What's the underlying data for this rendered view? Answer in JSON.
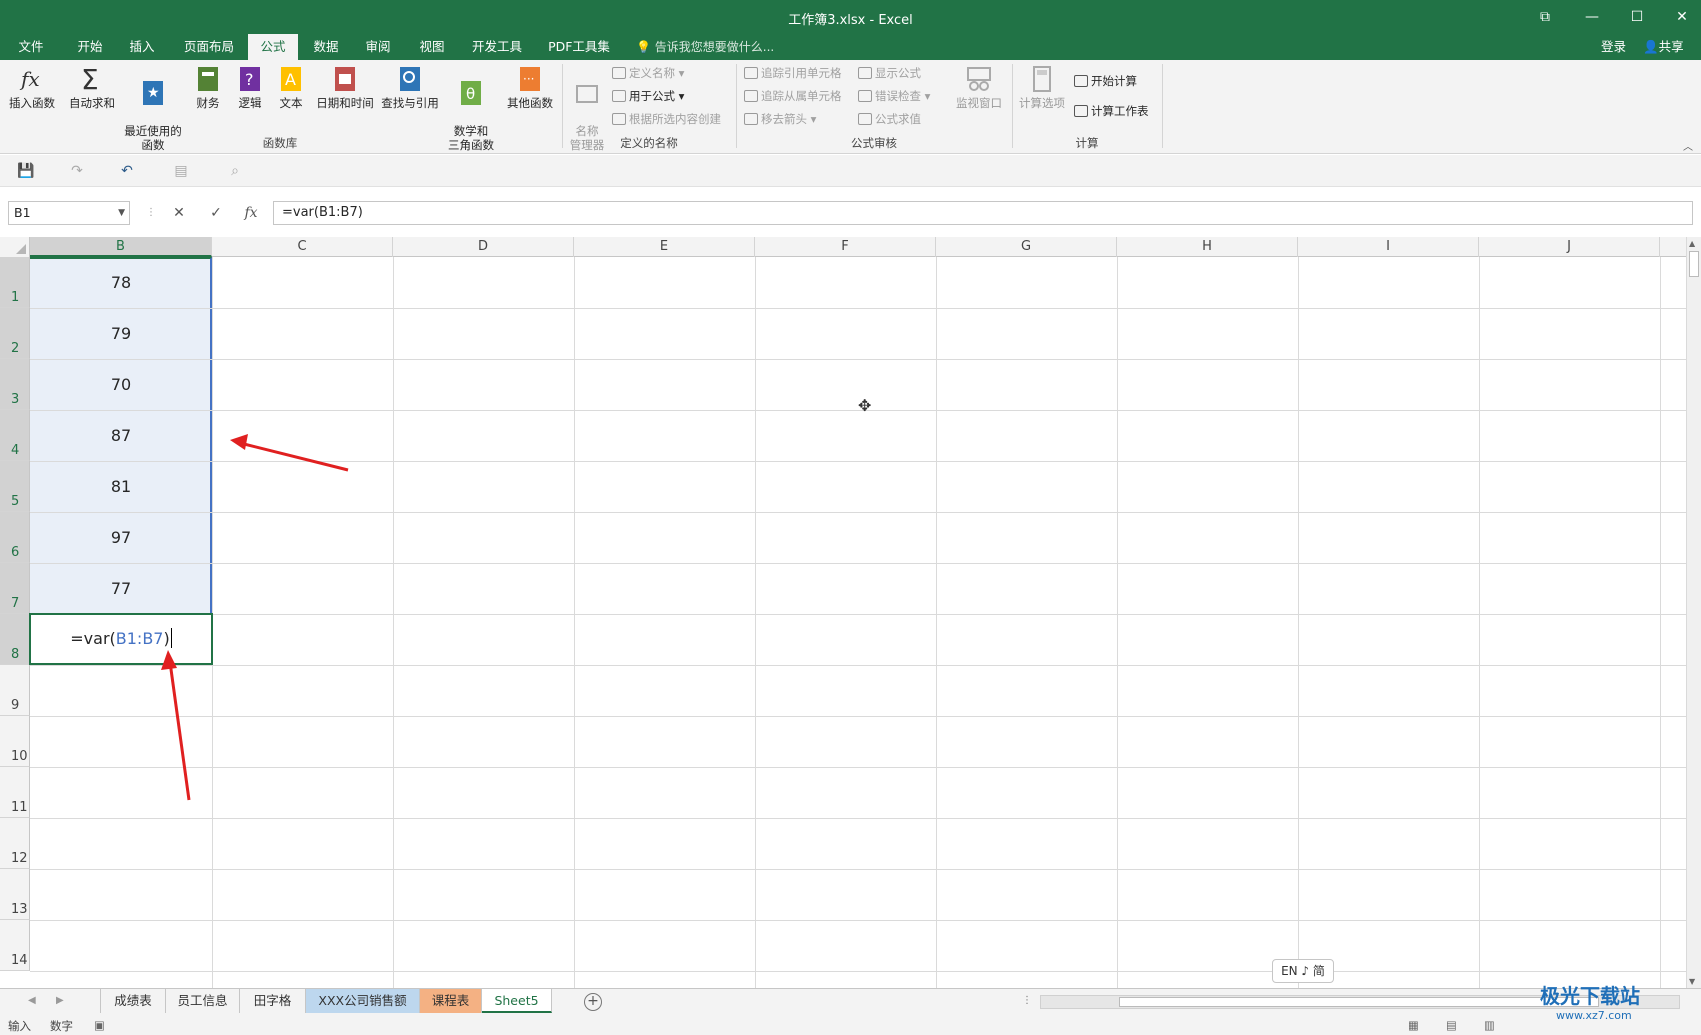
{
  "window": {
    "title": "工作簿3.xlsx - Excel",
    "controls": {
      "restore": "⧉",
      "minimize": "—",
      "maximize": "☐",
      "close": "✕"
    }
  },
  "tabs": [
    "文件",
    "开始",
    "插入",
    "页面布局",
    "公式",
    "数据",
    "审阅",
    "视图",
    "开发工具",
    "PDF工具集"
  ],
  "active_tab": "公式",
  "tell_me": "告诉我您想要做什么...",
  "login": "登录",
  "share": "共享",
  "ribbon": {
    "function_library": {
      "label": "函数库",
      "buttons": [
        "插入函数",
        "自动求和",
        "最近使用的\n函数",
        "财务",
        "逻辑",
        "文本",
        "日期和时间",
        "查找与引用",
        "数学和\n三角函数",
        "其他函数"
      ]
    },
    "defined_names": {
      "label": "定义的名称",
      "name_manager": "名称\n管理器",
      "items": [
        "定义名称",
        "用于公式",
        "根据所选内容创建"
      ]
    },
    "formula_auditing": {
      "label": "公式审核",
      "items": [
        "追踪引用单元格",
        "追踪从属单元格",
        "移去箭头",
        "显示公式",
        "错误检查",
        "公式求值"
      ],
      "watch_window": "监视窗口"
    },
    "calculation": {
      "label": "计算",
      "options": "计算选项",
      "items": [
        "开始计算",
        "计算工作表"
      ]
    }
  },
  "formula_bar": {
    "name_box": "B1",
    "formula": "=var(B1:B7)"
  },
  "columns": [
    "B",
    "C",
    "D",
    "E",
    "F",
    "G",
    "H",
    "I",
    "J"
  ],
  "rows": [
    "1",
    "2",
    "3",
    "4",
    "5",
    "6",
    "7",
    "8",
    "9",
    "10",
    "11",
    "12",
    "13",
    "14"
  ],
  "cells_B": [
    "78",
    "79",
    "70",
    "87",
    "81",
    "97",
    "77"
  ],
  "active_cell": {
    "prefix": "=var(",
    "ref": "B1:B7",
    "suffix": ")"
  },
  "ime": "EN ♪ 简",
  "sheets": [
    {
      "name": "成绩表",
      "style": "normal"
    },
    {
      "name": "员工信息",
      "style": "normal"
    },
    {
      "name": "田字格",
      "style": "normal"
    },
    {
      "name": "XXX公司销售额",
      "style": "blue"
    },
    {
      "name": "课程表",
      "style": "orange"
    },
    {
      "name": "Sheet5",
      "style": "active"
    }
  ],
  "status": {
    "mode": "输入",
    "numlock": "数字"
  },
  "watermark": {
    "name": "极光下载站",
    "url": "www.xz7.com"
  },
  "colors": {
    "excel_green": "#217346",
    "selection": "#e9eff8",
    "ref_blue": "#4472c4",
    "arrow_red": "#e02020"
  }
}
